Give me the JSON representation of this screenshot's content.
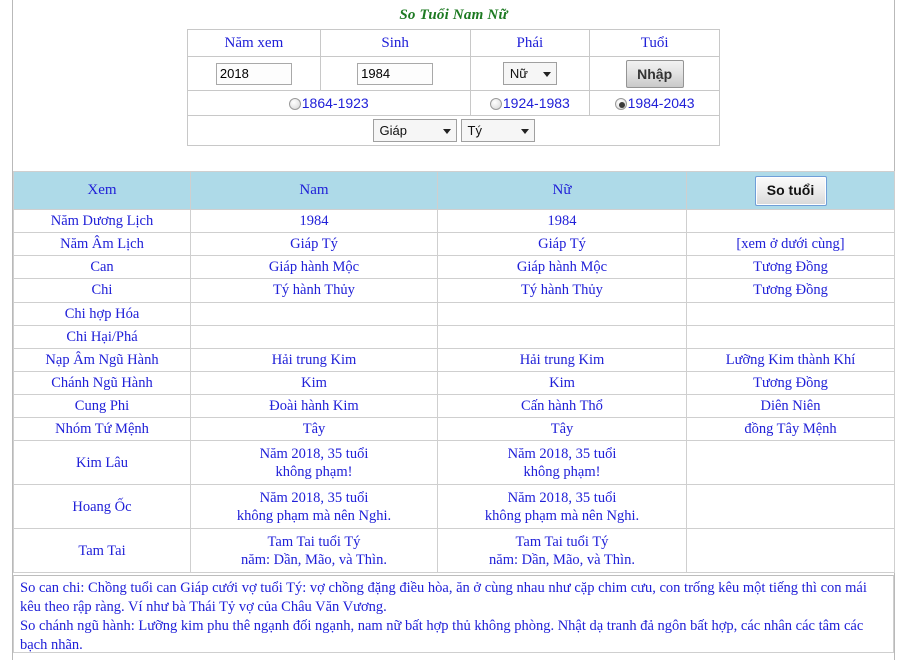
{
  "title": "So Tuổi Nam Nữ",
  "form": {
    "headers": [
      "Năm xem",
      "Sinh",
      "Phái",
      "Tuổi"
    ],
    "nam_xem_value": "2018",
    "sinh_value": "1984",
    "phai_value": "Nữ",
    "submit_label": "Nhập",
    "ranges": [
      {
        "label": "1864-1923",
        "selected": false
      },
      {
        "label": "1924-1983",
        "selected": false
      },
      {
        "label": "1984-2043",
        "selected": true
      }
    ],
    "can_value": "Giáp",
    "chi_value": "Tý"
  },
  "table": {
    "headers": [
      "Xem",
      "Nam",
      "Nữ",
      ""
    ],
    "compare_button_label": "So tuổi",
    "rows": [
      {
        "xem": "Năm Dương Lịch",
        "nam": "1984",
        "nu": "1984",
        "so": ""
      },
      {
        "xem": "Năm Âm Lịch",
        "nam": "Giáp Tý",
        "nu": "Giáp Tý",
        "so": "[xem ở dưới cùng]"
      },
      {
        "xem": "Can",
        "nam": "Giáp  hành Mộc",
        "nu": "Giáp  hành Mộc",
        "so": "Tương Đồng"
      },
      {
        "xem": "Chi",
        "nam": "Tý  hành Thủy",
        "nu": "Tý  hành Thủy",
        "so": "Tương Đồng"
      },
      {
        "xem": "Chi hợp Hóa",
        "nam": "",
        "nu": "",
        "so": ""
      },
      {
        "xem": "Chi Hại/Phá",
        "nam": "",
        "nu": "",
        "so": ""
      },
      {
        "xem": "Nạp Âm Ngũ Hành",
        "nam": "Hải trung Kim",
        "nu": "Hải trung Kim",
        "so": "Lưỡng Kim thành Khí"
      },
      {
        "xem": "Chánh Ngũ Hành",
        "nam": "Kim",
        "nu": "Kim",
        "so": "Tương Đồng"
      },
      {
        "xem": "Cung Phi",
        "nam": "Đoài  hành Kim",
        "nu": "Cấn  hành Thổ",
        "so": "Diên Niên"
      },
      {
        "xem": "Nhóm Tứ Mệnh",
        "nam": "Tây",
        "nu": "Tây",
        "so": "đồng Tây Mệnh"
      },
      {
        "xem": "Kim Lâu",
        "nam": "Năm 2018, 35 tuổi\nkhông phạm!",
        "nu": "Năm 2018, 35 tuổi\nkhông phạm!",
        "so": ""
      },
      {
        "xem": "Hoang Ốc",
        "nam": "Năm 2018, 35 tuổi\nkhông phạm mà nên Nghi.",
        "nu": "Năm 2018, 35 tuổi\nkhông phạm mà nên Nghi.",
        "so": ""
      },
      {
        "xem": "Tam Tai",
        "nam": "Tam Tai tuổi Tý\nnăm: Dần, Mão, và Thìn.",
        "nu": "Tam Tai tuổi Tý\nnăm: Dần, Mão, và Thìn.",
        "so": ""
      }
    ]
  },
  "note": {
    "line1": "So can chi: Chồng tuổi can Giáp cưới vợ tuổi Tý: vợ chồng đặng điều hòa, ăn ở cùng nhau như cặp chim cưu, con trống kêu một tiếng thì con mái kêu theo rập ràng. Ví như bà Thái Tỷ vợ của Châu Văn Vương.",
    "line2": "So chánh ngũ hành: Lưỡng kim phu thê ngạnh đối ngạnh, nam nữ bất hợp thủ không phòng. Nhật dạ tranh đả ngôn bất hợp, các nhân các tâm các bạch nhãn."
  },
  "colors": {
    "title_green": "#1d7a22",
    "text_blue": "#2020d8",
    "header_blue_bg": "#aedae8"
  }
}
